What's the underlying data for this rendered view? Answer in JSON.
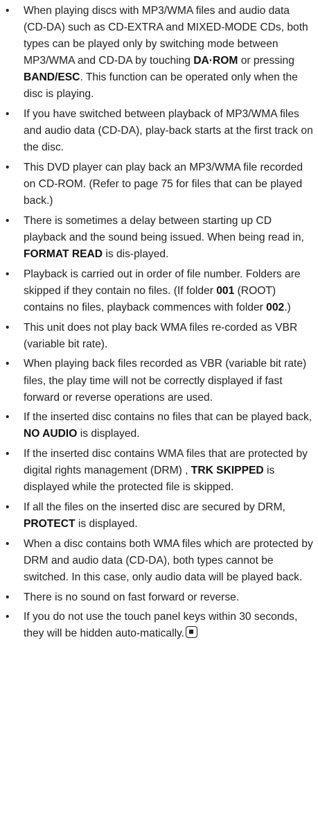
{
  "notes": [
    {
      "bullet": "•",
      "parts": [
        {
          "t": "When playing discs with MP3/WMA files and audio data (CD-DA) such as CD-EXTRA and MIXED-MODE CDs, both types can be played only by switching mode between MP3/WMA and CD-DA by touching "
        },
        {
          "t": "DA·ROM",
          "b": true
        },
        {
          "t": " or pressing "
        },
        {
          "t": "BAND/ESC",
          "b": true
        },
        {
          "t": ". This function can be operated only when the disc is playing."
        }
      ]
    },
    {
      "bullet": "•",
      "parts": [
        {
          "t": "If you have switched between playback of MP3/WMA files and audio data (CD-DA), play-back starts at the first track on the disc."
        }
      ]
    },
    {
      "bullet": "•",
      "parts": [
        {
          "t": "This DVD player can play back an MP3/WMA file recorded on CD-ROM. (Refer to page 75 for files that can be played back.)"
        }
      ]
    },
    {
      "bullet": "•",
      "parts": [
        {
          "t": "There is sometimes a delay between starting up CD playback and the sound being issued. When being read in, "
        },
        {
          "t": "FORMAT READ",
          "b": true
        },
        {
          "t": " is dis-played."
        }
      ]
    },
    {
      "bullet": "•",
      "parts": [
        {
          "t": "Playback is carried out in order of file number. Folders are skipped if they contain no files. (If folder "
        },
        {
          "t": "001",
          "b": true
        },
        {
          "t": " (ROOT) contains no files, playback commences with folder "
        },
        {
          "t": "002",
          "b": true
        },
        {
          "t": ".)"
        }
      ]
    },
    {
      "bullet": "•",
      "parts": [
        {
          "t": "This unit does not play back WMA files re-corded as VBR (variable bit rate)."
        }
      ]
    },
    {
      "bullet": "•",
      "parts": [
        {
          "t": "When playing back files recorded as VBR (variable bit rate) files, the play time will not be correctly displayed if fast forward or reverse operations are used."
        }
      ]
    },
    {
      "bullet": "•",
      "parts": [
        {
          "t": "If the inserted disc contains no files that can be played back, "
        },
        {
          "t": "NO AUDIO",
          "b": true
        },
        {
          "t": " is displayed."
        }
      ]
    },
    {
      "bullet": "•",
      "parts": [
        {
          "t": "If the inserted disc contains WMA files that are protected by digital rights management (DRM) , "
        },
        {
          "t": "TRK SKIPPED",
          "b": true
        },
        {
          "t": " is displayed while the protected file is skipped."
        }
      ]
    },
    {
      "bullet": "•",
      "parts": [
        {
          "t": "If all the files on the inserted disc are secured by DRM, "
        },
        {
          "t": "PROTECT",
          "b": true
        },
        {
          "t": " is displayed."
        }
      ]
    },
    {
      "bullet": "•",
      "parts": [
        {
          "t": "When a disc contains both WMA files which are protected by DRM and audio data (CD-DA), both types cannot be switched. In this case, only audio data will be played back."
        }
      ]
    },
    {
      "bullet": "•",
      "parts": [
        {
          "t": "There is no sound on fast forward or reverse."
        }
      ]
    },
    {
      "bullet": "•",
      "parts": [
        {
          "t": "If you do not use the touch panel keys within 30 seconds, they will be hidden auto-matically."
        }
      ],
      "end_mark": true
    }
  ]
}
